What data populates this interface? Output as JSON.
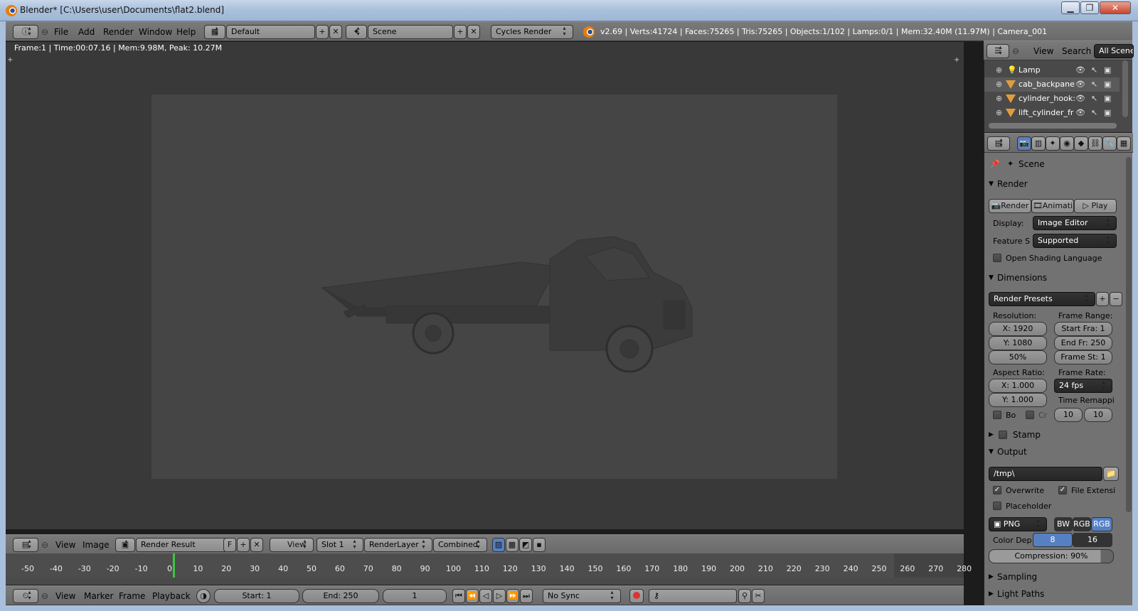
{
  "window": {
    "title": "Blender* [C:\\Users\\user\\Documents\\flat2.blend]",
    "controls": {
      "minimize": "▁",
      "maximize": "❐",
      "close": "✕"
    }
  },
  "info_header": {
    "menus": [
      "File",
      "Add",
      "Render",
      "Window",
      "Help"
    ],
    "screen_layout": "Default",
    "scene": "Scene",
    "render_engine": "Cycles Render",
    "stats": "v2.69 | Verts:41724 | Faces:75265 | Tris:75265 | Objects:1/102 | Lamps:0/1 | Mem:32.40M (11.97M) | Camera_001"
  },
  "viewport": {
    "frame_info": "Frame:1 | Time:00:07.16 | Mem:9.98M, Peak: 10.27M"
  },
  "image_editor_header": {
    "menus": [
      "View",
      "Image"
    ],
    "image_name": "Render Result",
    "fake_user": "F",
    "view_menu": "View",
    "slot": "Slot 1",
    "render_layer": "RenderLayer",
    "pass": "Combined"
  },
  "timeline": {
    "ticks": [
      "-50",
      "-40",
      "-30",
      "-20",
      "-10",
      "0",
      "10",
      "20",
      "30",
      "40",
      "50",
      "60",
      "70",
      "80",
      "90",
      "100",
      "110",
      "120",
      "130",
      "140",
      "150",
      "160",
      "170",
      "180",
      "190",
      "200",
      "210",
      "220",
      "230",
      "240",
      "250",
      "260",
      "270",
      "280"
    ],
    "current_frame": 0
  },
  "timeline_header": {
    "menus": [
      "View",
      "Marker",
      "Frame",
      "Playback"
    ],
    "start": "Start: 1",
    "end": "End: 250",
    "current": "1",
    "sync": "No Sync"
  },
  "outliner": {
    "menus": [
      "View",
      "Search"
    ],
    "filter": "All Scene",
    "rows": [
      {
        "name": "Lamp",
        "icon": "lamp-icon"
      },
      {
        "name": "cab_backpane",
        "icon": "mesh-icon"
      },
      {
        "name": "cylinder_hook:",
        "icon": "mesh-icon"
      },
      {
        "name": "lift_cylinder_fr",
        "icon": "mesh-icon"
      }
    ]
  },
  "properties": {
    "context": "Scene",
    "render": {
      "title": "Render",
      "buttons": {
        "render": "Render",
        "animation": "Animati",
        "play": "Play"
      },
      "display_label": "Display:",
      "display_value": "Image Editor",
      "feature_label": "Feature S",
      "feature_value": "Supported",
      "osl_label": "Open Shading Language"
    },
    "dimensions": {
      "title": "Dimensions",
      "presets": "Render Presets",
      "resolution_label": "Resolution:",
      "res_x": "X: 1920",
      "res_y": "Y: 1080",
      "res_pct": "50%",
      "frame_range_label": "Frame Range:",
      "start": "Start Fra: 1",
      "end": "End Fr: 250",
      "step": "Frame St: 1",
      "aspect_label": "Aspect Ratio:",
      "aspect_x": "X: 1.000",
      "aspect_y": "Y: 1.000",
      "frame_rate_label": "Frame Rate:",
      "fps": "24 fps",
      "time_remap_label": "Time Remappi",
      "remap_old": "10",
      "remap_new": "10",
      "border_label": "Bo",
      "crop_label": "Cr"
    },
    "stamp": {
      "title": "Stamp"
    },
    "output": {
      "title": "Output",
      "path": "/tmp\\",
      "overwrite": "Overwrite",
      "file_ext": "File Extensi",
      "placeholder": "Placeholder",
      "format": "PNG",
      "bw": "BW",
      "rgb": "RGB",
      "rgba": "RGB",
      "color_depth_label": "Color Dep",
      "depth_8": "8",
      "depth_16": "16",
      "compression": "Compression: 90%"
    },
    "sampling": {
      "title": "Sampling"
    },
    "light_paths": {
      "title": "Light Paths"
    }
  },
  "colors": {
    "accent_blue": "#5680c2",
    "timeline_cursor": "#3ec43e",
    "viewport_bg": "#393939"
  }
}
